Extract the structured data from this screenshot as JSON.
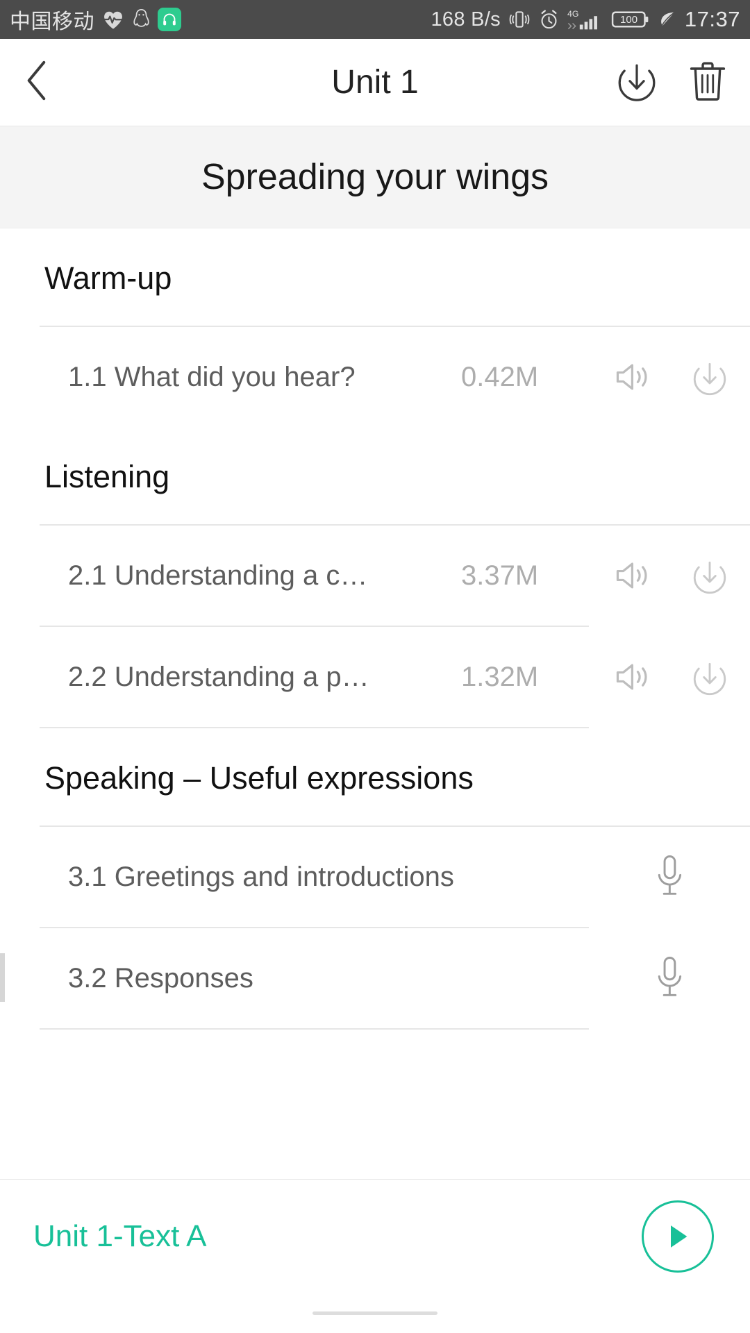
{
  "statusbar": {
    "carrier": "中国移动",
    "icons_left": [
      "heart-pulse-icon",
      "qq-penguin-icon",
      "headphone-app-icon"
    ],
    "network_speed": "168 B/s",
    "icons_right": [
      "vibrate-icon",
      "alarm-clock-icon",
      "signal-4g-icon",
      "battery-icon",
      "leaf-icon"
    ],
    "battery_level": "100",
    "network_type": "4G",
    "time": "17:37"
  },
  "appbar": {
    "title": "Unit 1",
    "back_icon": "chevron-left-icon",
    "download_icon": "download-circle-icon",
    "delete_icon": "trash-icon"
  },
  "banner": {
    "title": "Spreading your wings"
  },
  "sections": [
    {
      "title": "Warm-up",
      "rows": [
        {
          "label": "1.1 What did you hear?",
          "size": "0.42M",
          "type": "audio",
          "icons": [
            "speaker-icon",
            "download-circle-icon"
          ]
        }
      ]
    },
    {
      "title": "Listening",
      "rows": [
        {
          "label": "2.1 Understanding a c…",
          "size": "3.37M",
          "type": "audio",
          "icons": [
            "speaker-icon",
            "download-circle-icon"
          ]
        },
        {
          "label": "2.2 Understanding a p…",
          "size": "1.32M",
          "type": "audio",
          "icons": [
            "speaker-icon",
            "download-circle-icon"
          ]
        }
      ]
    },
    {
      "title": "Speaking – Useful expressions",
      "rows": [
        {
          "label": "3.1 Greetings and introductions",
          "size": "",
          "type": "record",
          "icons": [
            "microphone-icon"
          ]
        },
        {
          "label": "3.2 Responses",
          "size": "",
          "type": "record",
          "icons": [
            "microphone-icon"
          ]
        }
      ]
    }
  ],
  "player": {
    "title": "Unit 1-Text A",
    "play_icon": "play-triangle-icon"
  },
  "colors": {
    "accent": "#18c098",
    "statusbar_bg": "#4b4b4b",
    "banner_bg": "#f4f4f4",
    "row_text": "#5d5d5d",
    "size_text": "#adadad",
    "app_badge": "#2ecc8f"
  }
}
